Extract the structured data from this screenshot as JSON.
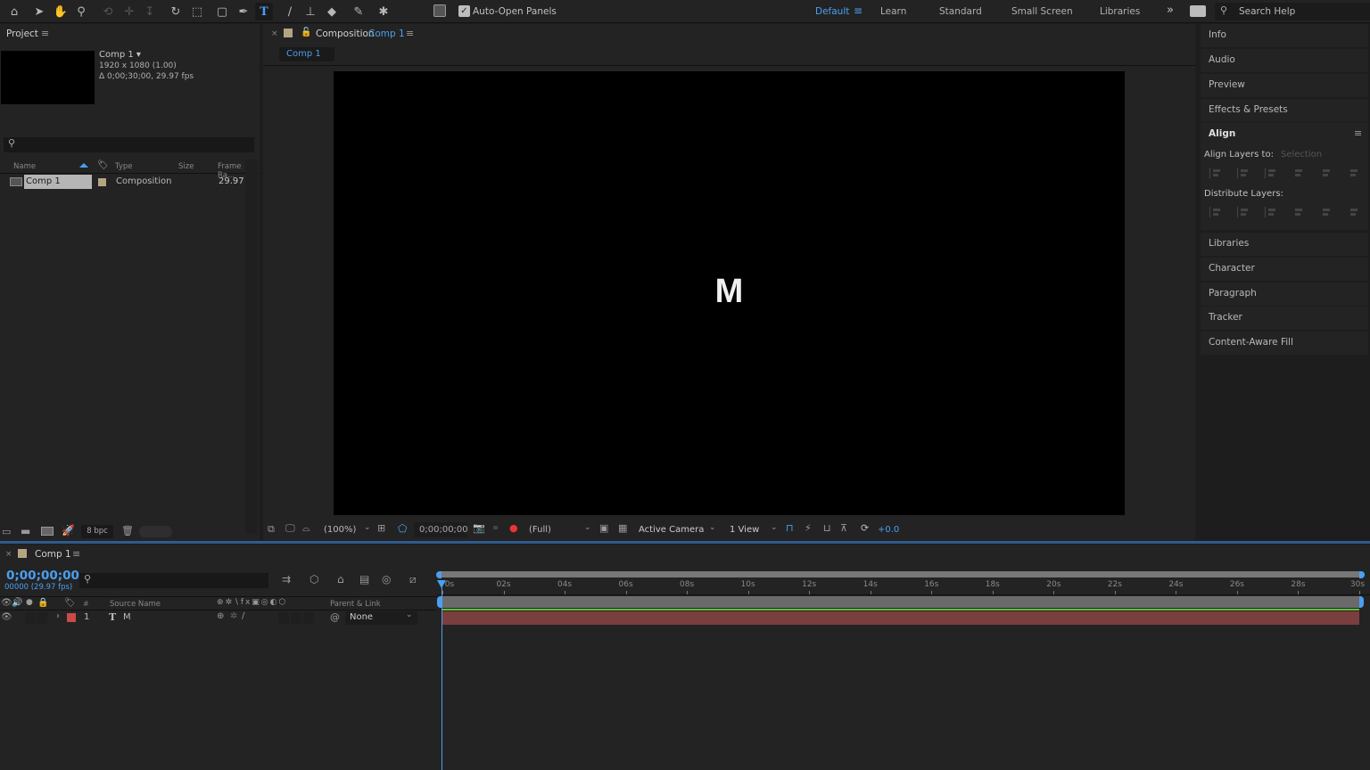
{
  "toolbar": {
    "tools": [
      {
        "name": "home-icon",
        "glyph": "⌂"
      },
      {
        "name": "selection-tool-icon",
        "glyph": "➤"
      },
      {
        "name": "hand-tool-icon",
        "glyph": "✋"
      },
      {
        "name": "zoom-tool-icon",
        "glyph": "⚲"
      },
      {
        "name": "orbit-camera-icon",
        "glyph": "⟲"
      },
      {
        "name": "pan-camera-icon",
        "glyph": "✛"
      },
      {
        "name": "dolly-camera-icon",
        "glyph": "↧"
      },
      {
        "name": "rotation-tool-icon",
        "glyph": "↻"
      },
      {
        "name": "pan-behind-icon",
        "glyph": "⬚"
      },
      {
        "name": "rectangle-tool-icon",
        "glyph": "▢"
      },
      {
        "name": "pen-tool-icon",
        "glyph": "✒"
      },
      {
        "name": "type-tool-icon",
        "glyph": "T"
      },
      {
        "name": "brush-tool-icon",
        "glyph": "∕"
      },
      {
        "name": "clone-stamp-icon",
        "glyph": "⊥"
      },
      {
        "name": "eraser-tool-icon",
        "glyph": "◆"
      },
      {
        "name": "roto-brush-icon",
        "glyph": "✎"
      },
      {
        "name": "puppet-pin-icon",
        "glyph": "✱"
      }
    ],
    "auto_open_label": "Auto-Open Panels",
    "auto_open_checked": true,
    "workspaces": [
      "Default",
      "Learn",
      "Standard",
      "Small Screen",
      "Libraries"
    ],
    "active_workspace": "Default",
    "overflow": "»",
    "search_placeholder": "Search Help"
  },
  "project": {
    "title": "Project",
    "comp_name": "Comp 1 ▾",
    "comp_size": "1920 x 1080 (1.00)",
    "comp_duration": "Δ 0;00;30;00, 29.97 fps",
    "columns": [
      "Name",
      "Type",
      "Size",
      "Frame Ra..."
    ],
    "items": [
      {
        "name": "Comp 1",
        "type": "Composition",
        "size": "",
        "frame_rate": "29.97",
        "label_color": "#b5a482"
      }
    ],
    "bpc": "8 bpc"
  },
  "composition": {
    "title": "Composition",
    "comp_name": "Comp 1",
    "tab": "Comp 1",
    "label_color": "#b5a482",
    "viewer_text": "M",
    "zoom": "(100%)",
    "timecode": "0;00;00;00",
    "resolution": "(Full)",
    "camera": "Active Camera",
    "views": "1 View",
    "exposure": "+0.0"
  },
  "right_panel": {
    "items_top": [
      "Info",
      "Audio",
      "Preview",
      "Effects & Presets"
    ],
    "align": {
      "title": "Align",
      "align_to_label": "Align Layers to:",
      "align_to_value": "Selection",
      "distribute_label": "Distribute Layers:"
    },
    "items_bottom": [
      "Libraries",
      "Character",
      "Paragraph",
      "Tracker",
      "Content-Aware Fill"
    ]
  },
  "timeline": {
    "tab": "Comp 1",
    "timecode": "0;00;00;00",
    "frame_info": "00000 (29.97 fps)",
    "columns": {
      "number": "#",
      "source_name": "Source Name",
      "parent": "Parent & Link"
    },
    "layers": [
      {
        "index": "1",
        "type_glyph": "T",
        "name": "M",
        "label_color": "#c94a48",
        "parent": "None"
      }
    ],
    "ruler": [
      "0s",
      "02s",
      "04s",
      "06s",
      "08s",
      "10s",
      "12s",
      "14s",
      "16s",
      "18s",
      "20s",
      "22s",
      "24s",
      "26s",
      "28s",
      "30s"
    ],
    "duration_seconds": 30,
    "playhead_seconds": 0
  },
  "colors": {
    "accent": "#4b9ff0",
    "layer_bar": "#7a3e3e",
    "green_bar": "#5dbf3a",
    "work_area": "#6a6a6a"
  }
}
